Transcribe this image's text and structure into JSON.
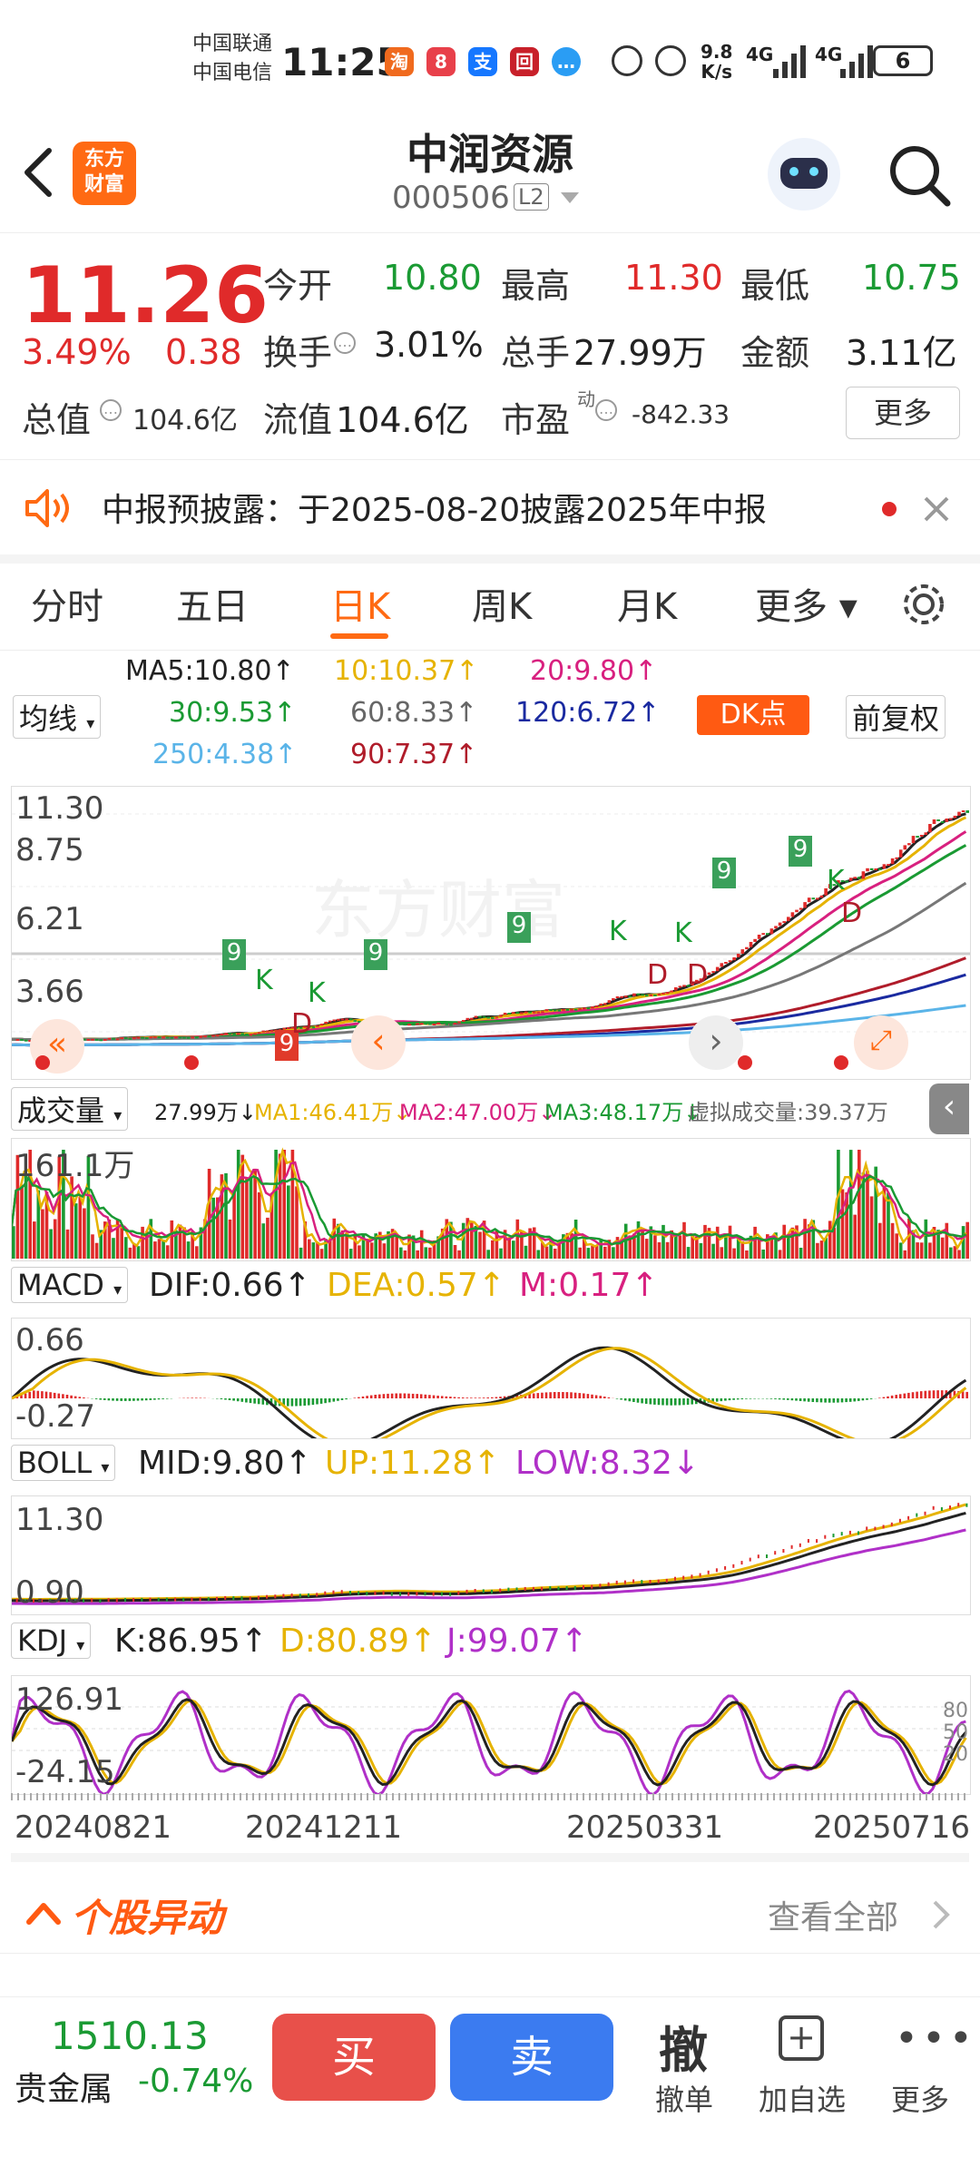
{
  "status_bar": {
    "carrier1": "中国联通",
    "carrier2": "中国电信",
    "time": "11:25",
    "net_speed_top": "9.8",
    "net_speed_bottom": "K/s",
    "signal1": "4G",
    "signal2": "4G",
    "battery": "6"
  },
  "header": {
    "back_icon": "chevron-left-icon",
    "logo_text": "东方\n财富",
    "title": "中润资源",
    "code": "000506",
    "level": "L2",
    "mascot_icon": "robot-mascot-icon",
    "search_icon": "search-icon"
  },
  "quote": {
    "price": "11.26",
    "pct": "3.49%",
    "change": "0.38",
    "open_label": "今开",
    "open": "10.80",
    "high_label": "最高",
    "high": "11.30",
    "low_label": "最低",
    "low": "10.75",
    "turnover_label": "换手",
    "turnover": "3.01%",
    "volume_label": "总手",
    "volume": "27.99万",
    "amount_label": "金额",
    "amount": "3.11亿",
    "total_cap_label": "总值",
    "total_cap": "104.6亿",
    "float_cap_label": "流值",
    "float_cap": "104.6亿",
    "pe_label": "市盈",
    "pe_sup": "动",
    "pe": "-842.33",
    "more_label": "更多"
  },
  "notice": {
    "text": "中报预披露：于2025-08-20披露2025年中报"
  },
  "tabs": [
    {
      "label": "分时",
      "active": false
    },
    {
      "label": "五日",
      "active": false
    },
    {
      "label": "日K",
      "active": true
    },
    {
      "label": "周K",
      "active": false
    },
    {
      "label": "月K",
      "active": false
    },
    {
      "label": "更多 ▾",
      "active": false
    }
  ],
  "ma_legend": {
    "selector": "均线",
    "ma5": "MA5:10.80↑",
    "ma10": "10:10.37↑",
    "ma20": "20:9.80↑",
    "ma30": "30:9.53↑",
    "ma60": "60:8.33↑",
    "ma120": "120:6.72↑",
    "ma250": "250:4.38↑",
    "ma90": "90:7.37↑",
    "dk_button": "DK点",
    "adjust_button": "前复权"
  },
  "kline": {
    "y_labels": [
      "11.30",
      "8.75",
      "6.21",
      "3.66"
    ],
    "watermark": "东方财富"
  },
  "volume_panel": {
    "selector": "成交量",
    "vol": "27.99万↓",
    "ma1": "MA1:46.41万↓",
    "ma2": "MA2:47.00万↓",
    "ma3": "MA3:48.17万↓",
    "virtual": "虚拟成交量:39.37万",
    "y_label": "161.1万"
  },
  "macd_panel": {
    "selector": "MACD",
    "dif": "DIF:0.66↑",
    "dea": "DEA:0.57↑",
    "m": "M:0.17↑",
    "y_top": "0.66",
    "y_bottom": "-0.27"
  },
  "boll_panel": {
    "selector": "BOLL",
    "mid": "MID:9.80↑",
    "up": "UP:11.28↑",
    "low": "LOW:8.32↓",
    "y_top": "11.30",
    "y_bottom": "0.90"
  },
  "kdj_panel": {
    "selector": "KDJ",
    "k": "K:86.95↑",
    "d": "D:80.89↑",
    "j": "J:99.07↑",
    "y_top": "126.91",
    "y_bottom": "-24.15",
    "right_top": "80",
    "right_mid": "50",
    "right_bottom": "20"
  },
  "x_axis": [
    "20240821",
    "20241211",
    "20250331",
    "20250716"
  ],
  "movement": {
    "title": "个股异动",
    "view_all": "查看全部"
  },
  "bottom_bar": {
    "index_value": "1510.13",
    "index_name": "贵金属",
    "index_pct": "-0.74%",
    "buy": "买",
    "sell": "卖",
    "cancel_glyph": "撤",
    "cancel": "撤单",
    "add_watch": "加自选",
    "more": "更多"
  },
  "colors": {
    "up": "#e02a2a",
    "down": "#1a9a33",
    "accent": "#ff6a13",
    "buy_btn": "#e8504a",
    "sell_btn": "#3b7bf0",
    "ma5": "#222222",
    "ma10": "#e6b300",
    "ma20": "#d8207f",
    "ma30": "#1a9a33",
    "ma60": "#666666",
    "ma120": "#1a2aa0",
    "ma250": "#5ab4e8",
    "ma90": "#b01c2a"
  }
}
